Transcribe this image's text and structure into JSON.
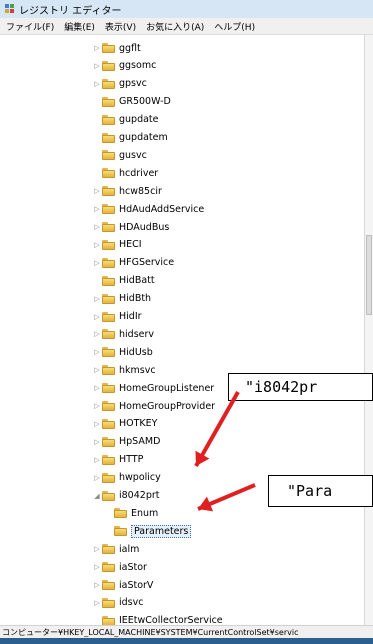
{
  "window": {
    "title": "レジストリ エディター"
  },
  "menu": [
    "ファイル(F)",
    "編集(E)",
    "表示(V)",
    "お気に入り(A)",
    "ヘルプ(H)"
  ],
  "tree": [
    {
      "label": "ggflt",
      "level": 0,
      "expander": "▷"
    },
    {
      "label": "ggsomc",
      "level": 0,
      "expander": "▷"
    },
    {
      "label": "gpsvc",
      "level": 0,
      "expander": "▷"
    },
    {
      "label": "GR500W-D",
      "level": 0,
      "expander": ""
    },
    {
      "label": "gupdate",
      "level": 0,
      "expander": ""
    },
    {
      "label": "gupdatem",
      "level": 0,
      "expander": ""
    },
    {
      "label": "gusvc",
      "level": 0,
      "expander": ""
    },
    {
      "label": "hcdriver",
      "level": 0,
      "expander": ""
    },
    {
      "label": "hcw85cir",
      "level": 0,
      "expander": "▷"
    },
    {
      "label": "HdAudAddService",
      "level": 0,
      "expander": "▷"
    },
    {
      "label": "HDAudBus",
      "level": 0,
      "expander": "▷"
    },
    {
      "label": "HECI",
      "level": 0,
      "expander": "▷"
    },
    {
      "label": "HFGService",
      "level": 0,
      "expander": "▷"
    },
    {
      "label": "HidBatt",
      "level": 0,
      "expander": ""
    },
    {
      "label": "HidBth",
      "level": 0,
      "expander": "▷"
    },
    {
      "label": "HidIr",
      "level": 0,
      "expander": "▷"
    },
    {
      "label": "hidserv",
      "level": 0,
      "expander": "▷"
    },
    {
      "label": "HidUsb",
      "level": 0,
      "expander": "▷"
    },
    {
      "label": "hkmsvc",
      "level": 0,
      "expander": "▷"
    },
    {
      "label": "HomeGroupListener",
      "level": 0,
      "expander": "▷"
    },
    {
      "label": "HomeGroupProvider",
      "level": 0,
      "expander": "▷"
    },
    {
      "label": "HOTKEY",
      "level": 0,
      "expander": "▷"
    },
    {
      "label": "HpSAMD",
      "level": 0,
      "expander": "▷"
    },
    {
      "label": "HTTP",
      "level": 0,
      "expander": "▷"
    },
    {
      "label": "hwpolicy",
      "level": 0,
      "expander": "▷"
    },
    {
      "label": "i8042prt",
      "level": 0,
      "expander": "◢"
    },
    {
      "label": "Enum",
      "level": 1,
      "expander": ""
    },
    {
      "label": "Parameters",
      "level": 1,
      "expander": "",
      "selected": true
    },
    {
      "label": "ialm",
      "level": 0,
      "expander": "▷"
    },
    {
      "label": "iaStor",
      "level": 0,
      "expander": "▷"
    },
    {
      "label": "iaStorV",
      "level": 0,
      "expander": "▷"
    },
    {
      "label": "idsvc",
      "level": 0,
      "expander": "▷"
    },
    {
      "label": "IEEtwCollectorService",
      "level": 0,
      "expander": ""
    }
  ],
  "statusbar": "コンピューター¥HKEY_LOCAL_MACHINE¥SYSTEM¥CurrentControlSet¥servic",
  "callouts": [
    {
      "text": "\"i8042pr"
    },
    {
      "text": "\"Para"
    }
  ],
  "colors": {
    "arrow": "#e02020",
    "taskbar": "#2b5f8f"
  }
}
